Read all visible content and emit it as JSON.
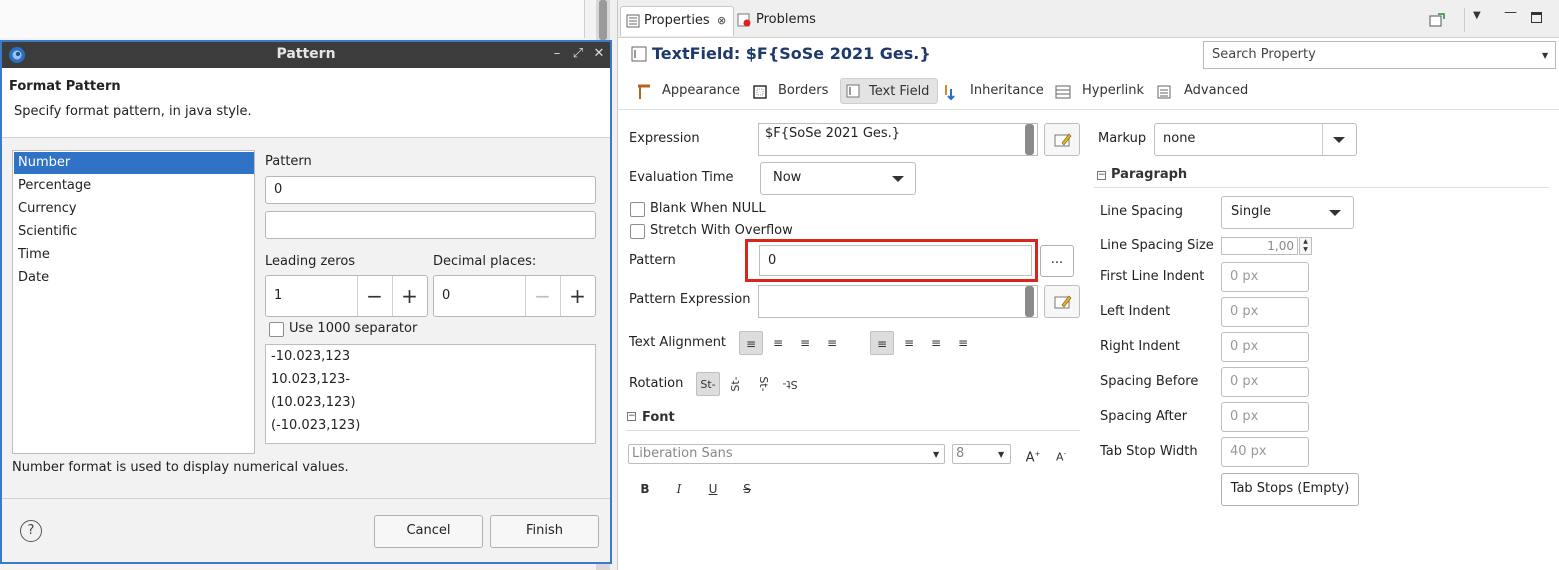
{
  "dialog": {
    "title": "Pattern",
    "heading": "Format Pattern",
    "description": "Specify format pattern, in java style.",
    "types": [
      "Number",
      "Percentage",
      "Currency",
      "Scientific",
      "Time",
      "Date"
    ],
    "selected_type": "Number",
    "pattern_label": "Pattern",
    "pattern_value": "0",
    "preview_value": "",
    "leading_zeros_label": "Leading zeros",
    "leading_zeros_value": "1",
    "decimal_places_label": "Decimal places:",
    "decimal_places_value": "0",
    "separator_label": "Use 1000 separator",
    "samples": [
      "-10.023,123",
      "10.023,123-",
      "(10.023,123)",
      "(-10.023,123)"
    ],
    "hint": "Number format is used to display numerical values.",
    "cancel_label": "Cancel",
    "finish_label": "Finish",
    "help_icon": "?"
  },
  "panel": {
    "tabs": [
      "Properties",
      "Problems"
    ],
    "title": "TextField: $F{SoSe 2021  Ges.}",
    "search_placeholder": "Search Property",
    "section_tabs": [
      "Appearance",
      "Borders",
      "Text Field",
      "Inheritance",
      "Hyperlink",
      "Advanced"
    ],
    "active_section": "Text Field",
    "expression_label": "Expression",
    "expression_value": "$F{SoSe 2021  Ges.}",
    "evaluation_time_label": "Evaluation Time",
    "evaluation_time_value": "Now",
    "blank_when_null_label": "Blank When NULL",
    "stretch_label": "Stretch With Overflow",
    "pattern_label": "Pattern",
    "pattern_value": "0",
    "ellipsis": "...",
    "pattern_expression_label": "Pattern Expression",
    "text_alignment_label": "Text Alignment",
    "rotation_label": "Rotation",
    "font_section": "Font",
    "font_name": "Liberation Sans",
    "font_size": "8",
    "markup_label": "Markup",
    "markup_value": "none",
    "paragraph_section": "Paragraph",
    "line_spacing_label": "Line Spacing",
    "line_spacing_value": "Single",
    "line_spacing_size_label": "Line Spacing Size",
    "line_spacing_size_value": "1,00",
    "first_line_indent_label": "First Line Indent",
    "left_indent_label": "Left Indent",
    "right_indent_label": "Right Indent",
    "spacing_before_label": "Spacing Before",
    "spacing_after_label": "Spacing After",
    "tab_stop_width_label": "Tab Stop Width",
    "px_placeholder": "0 px",
    "tab_stop_width_placeholder": "40 px",
    "tab_stops_button": "Tab Stops (Empty)",
    "highlight_color": "#d9261c"
  }
}
